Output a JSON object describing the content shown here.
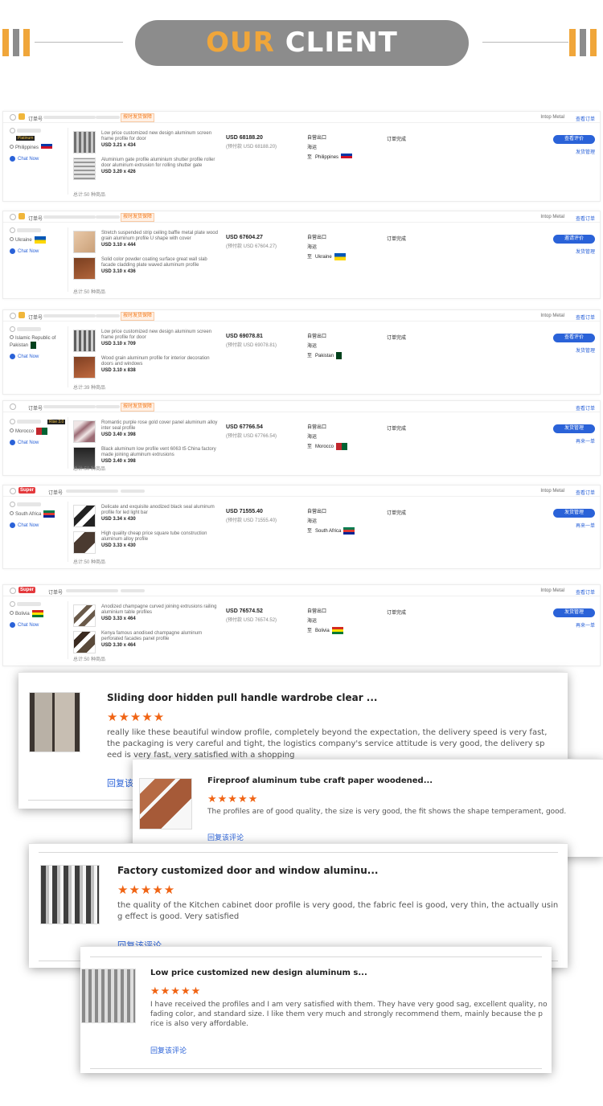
{
  "header": {
    "title_highlight": "OUR",
    "title_rest": " CLIENT"
  },
  "labels": {
    "order_no": "订单号",
    "total_prefix": "总计:",
    "chat": "Chat Now",
    "logistics": "自营出口",
    "ship_method": "海运",
    "dest_prefix": "至",
    "store": "Intop Metal",
    "tracking": "查看订单",
    "promise_tag": "按时发货保障"
  },
  "orders": [
    {
      "badge": "vip",
      "country": "Philippines",
      "level": "Platinum",
      "price": "USD 68188.20",
      "price_paid": "(预付款 USD 68188.20)",
      "status": "订单完成",
      "button": "查看评价",
      "sub_action": "发货管理",
      "total": "50 种商品",
      "store": "Intop Metal",
      "flag_colors": [
        "#0038a8",
        "#ce1126",
        "#ffffff"
      ],
      "items": [
        {
          "desc": "Low price customized new design aluminum screen frame profile for door",
          "qty": "USD 3.21 x 434"
        },
        {
          "desc": "Aluminium gate profile aluminium shutter profile roller door aluminum extrusion for rolling shutter gate",
          "qty": "USD 3.20 x 426"
        }
      ]
    },
    {
      "badge": "vip",
      "country": "Ukraine",
      "level": "",
      "price": "USD 67604.27",
      "price_paid": "(预付款 USD 67604.27)",
      "status": "订单完成",
      "button": "邀请评价",
      "sub_action": "发货管理",
      "total": "50 种商品",
      "store": "Intop Metal",
      "flag_colors": [
        "#0057b7",
        "#ffd700"
      ],
      "items": [
        {
          "desc": "Stretch suspended strip ceiling baffle metal plate wood grain aluminum profile U shape with cover",
          "qty": "USD 3.10 x 444"
        },
        {
          "desc": "Solid color powder coating surface great wall slab facade cladding plate waved aluminum profile",
          "qty": "USD 3.10 x 436"
        }
      ]
    },
    {
      "badge": "vip",
      "country": "Islamic Republic of Pakistan",
      "country_short": "Pakistan",
      "level": "",
      "price": "USD 69078.81",
      "price_paid": "(预付款 USD 69078.81)",
      "status": "订单完成",
      "button": "查看评价",
      "sub_action": "发货管理",
      "total": "39 种商品",
      "store": "Intop Metal",
      "flag_colors": [
        "#01411c",
        "#ffffff"
      ],
      "items": [
        {
          "desc": "Low price customized new design aluminum screen frame profile for door",
          "qty": "USD 3.10 x 709"
        },
        {
          "desc": "Wood grain aluminum profile for interior decoration doors and windows",
          "qty": "USD 3.10 x 838"
        }
      ]
    },
    {
      "badge": "none",
      "country": "Morocco",
      "level": "Rise 3.0",
      "price": "USD 67766.54",
      "price_paid": "(预付款 USD 67766.54)",
      "status": "订单完成",
      "button": "发货管理",
      "sub_action": "再来一单",
      "total": "50 种商品",
      "store": "",
      "flag_colors": [
        "#c1272d",
        "#006233"
      ],
      "items": [
        {
          "desc": "Romantic purple rose gold cover panel aluminum alloy inter seal profile",
          "qty": "USD 3.40 x 398"
        },
        {
          "desc": "Black aluminum low profile vent 6063 t5 China factory made joining aluminum extrusions",
          "qty": "USD 3.40 x 398"
        }
      ]
    },
    {
      "badge": "super",
      "country": "South Africa",
      "level": "",
      "price": "USD 71555.40",
      "price_paid": "(预付款 USD 71555.40)",
      "status": "订单完成",
      "button": "发货管理",
      "sub_action": "再来一单",
      "total": "50 种商品",
      "store": "Intop Metal",
      "flag_colors": [
        "#007a4d",
        "#de3831",
        "#002395",
        "#ffb612"
      ],
      "items": [
        {
          "desc": "Delicate and exquisite anodized black seal aluminum profile for led light bar",
          "qty": "USD 3.34 x 430"
        },
        {
          "desc": "High quality cheap price square tube construction aluminum alloy profile",
          "qty": "USD 3.33 x 430"
        }
      ]
    },
    {
      "badge": "super",
      "country": "Bolivia",
      "level": "",
      "price": "USD 76574.52",
      "price_paid": "(预付款 USD 76574.52)",
      "status": "订单完成",
      "button": "发货管理",
      "sub_action": "再来一单",
      "total": "50 种商品",
      "store": "Intop Metal",
      "flag_colors": [
        "#d52b1e",
        "#f9e300",
        "#007934"
      ],
      "items": [
        {
          "desc": "Anodized champagne curved joining extrusions railing aluminium table profiles",
          "qty": "USD 3.33 x 464"
        },
        {
          "desc": "Kenya famous anodised champagne aluminum perforated facades panel profile",
          "qty": "USD 3.30 x 464"
        }
      ]
    }
  ],
  "reviews": [
    {
      "title": "Sliding door hidden pull handle wardrobe clear ...",
      "stars": "★★★★★",
      "text_lines": [
        "really like these beautiful window profile, completely beyond the expectation, the delivery speed is very fast,",
        "the packaging is very careful and tight, the logistics company's service attitude is very good, the delivery sp",
        "eed is very fast, very satisfied with a shopping"
      ],
      "reply": "回复该评论"
    },
    {
      "title": "Fireproof aluminum tube craft paper woodened...",
      "stars": "★★★★★",
      "text_lines": [
        "The profiles are of good quality, the size is very good, the fit shows the shape temperament, good."
      ],
      "reply": "回复该评论"
    },
    {
      "title": "Factory customized door and window aluminu...",
      "stars": "★★★★★",
      "text_lines": [
        "the quality of the Kitchen cabinet door profile is very good, the fabric feel is good, very thin, the actually usin",
        "g effect is good. Very satisfied"
      ],
      "reply": "回复该评论"
    },
    {
      "title": "Low price customized new design aluminum s...",
      "stars": "★★★★★",
      "text_lines": [
        "I have received the profiles and I am very satisfied with them. They have very good sag, excellent quality, no",
        "fading color, and standard size. I like them very much and strongly recommend them, mainly because the p",
        "rice is also very affordable."
      ],
      "reply": "回复该评论"
    }
  ]
}
